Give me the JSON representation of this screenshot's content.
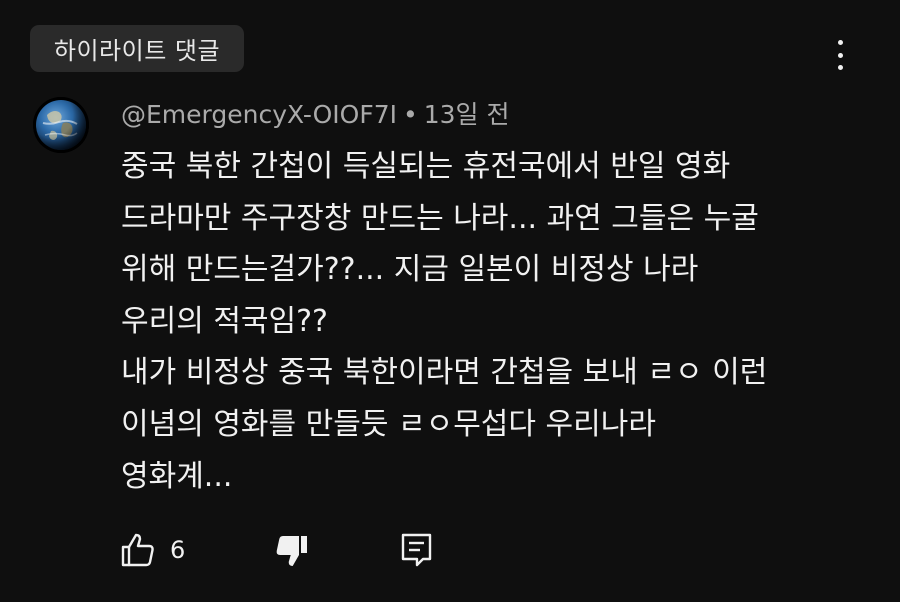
{
  "header": {
    "chip_label": "하이라이트 댓글"
  },
  "comment": {
    "author": "@EmergencyX-OIOF7I",
    "separator": "•",
    "time": "13일 전",
    "lines": [
      "중국 북한 간첩이 득실되는 휴전국에서 반일 영화",
      "드라마만 주구장창 만드는 나라... 과연 그들은 누굴",
      "위해 만드는걸가??... 지금 일본이 비정상 나라",
      "우리의 적국임??",
      "내가 비정상 중국 북한이라면 간첩을 보내 ㄹㅇ 이런",
      "이념의 영화를 만들듯 ㄹㅇ무섭다 우리나라",
      "영화계..."
    ],
    "like_count": "6"
  },
  "icons": {
    "menu": "more-vert-icon",
    "avatar": "earth-globe-avatar",
    "like": "thumbs-up-outline-icon",
    "dislike": "thumbs-down-filled-icon",
    "reply": "reply-comment-icon"
  },
  "colors": {
    "background": "#0f0f0f",
    "chip_bg": "#2a2a2a",
    "text_primary": "#f1f1f1",
    "text_secondary": "#aaaaaa"
  }
}
